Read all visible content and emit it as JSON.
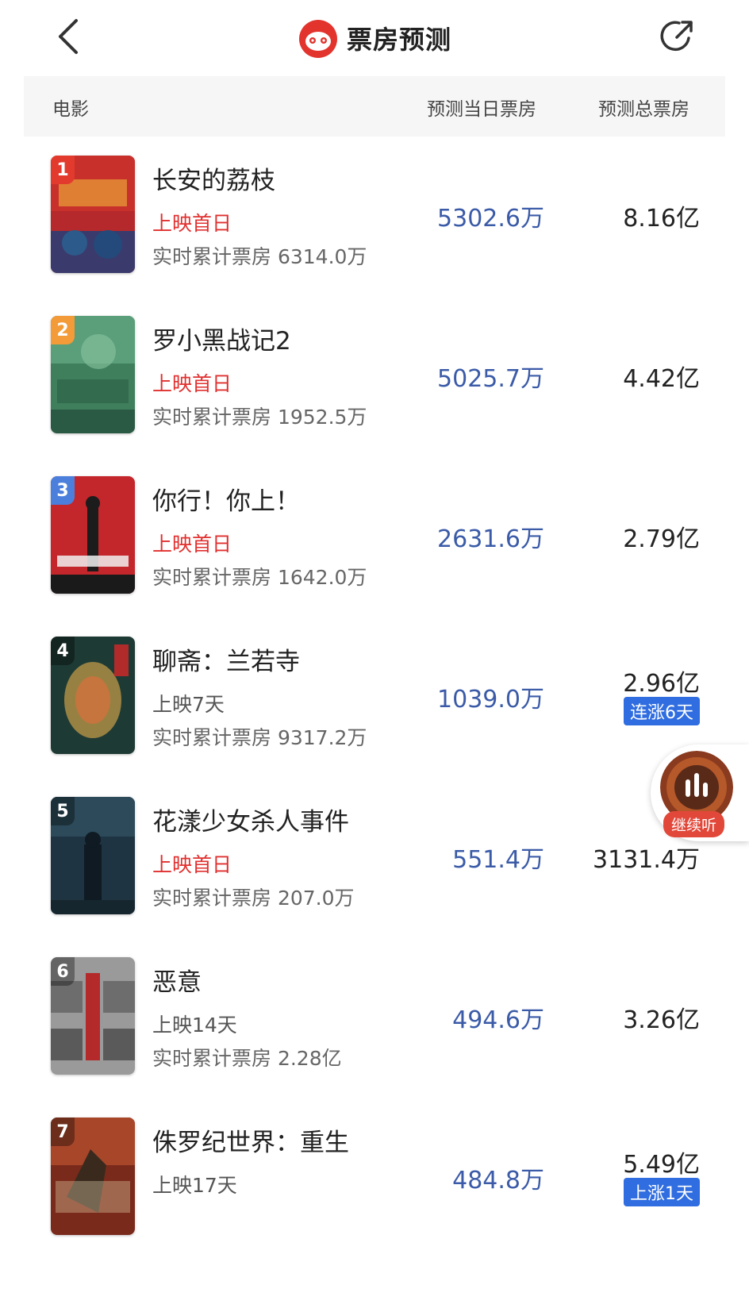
{
  "header": {
    "title": "票房预测",
    "back_icon": "chevron-left-icon",
    "share_icon": "share-arrow-icon",
    "logo_icon": "maoyan-cat-logo"
  },
  "columns": {
    "movie": "电影",
    "daily": "预测当日票房",
    "total": "预测总票房"
  },
  "movies": [
    {
      "rank": "1",
      "name": "长安的荔枝",
      "release": "上映首日",
      "cumulative": "实时累计票房 6314.0万",
      "daily": "5302.6万",
      "total": "8.16亿",
      "badge": "",
      "poster_color": "#b5282b"
    },
    {
      "rank": "2",
      "name": "罗小黑战记2",
      "release": "上映首日",
      "cumulative": "实时累计票房 1952.5万",
      "daily": "5025.7万",
      "total": "4.42亿",
      "badge": "",
      "poster_color": "#3f7f5c"
    },
    {
      "rank": "3",
      "name": "你行！你上！",
      "release": "上映首日",
      "cumulative": "实时累计票房 1642.0万",
      "daily": "2631.6万",
      "total": "2.79亿",
      "badge": "",
      "poster_color": "#c3262b"
    },
    {
      "rank": "4",
      "name": "聊斋：兰若寺",
      "release": "上映7天",
      "cumulative": "实时累计票房 9317.2万",
      "daily": "1039.0万",
      "total": "2.96亿",
      "badge": "连涨6天",
      "poster_color": "#1e3a34"
    },
    {
      "rank": "5",
      "name": "花漾少女杀人事件",
      "release": "上映首日",
      "cumulative": "实时累计票房 207.0万",
      "daily": "551.4万",
      "total": "3131.4万",
      "badge": "",
      "poster_color": "#1f3442"
    },
    {
      "rank": "6",
      "name": "恶意",
      "release": "上映14天",
      "cumulative": "实时累计票房 2.28亿",
      "daily": "494.6万",
      "total": "3.26亿",
      "badge": "",
      "poster_color": "#8a8a8a"
    },
    {
      "rank": "7",
      "name": "侏罗纪世界：重生",
      "release": "上映17天",
      "cumulative": "",
      "daily": "484.8万",
      "total": "5.49亿",
      "badge": "上涨1天",
      "poster_color": "#7a2a1a"
    }
  ],
  "float_player": {
    "label": "继续听",
    "icon": "audio-bars-icon"
  },
  "colors": {
    "accent_red": "#e0302f",
    "daily_blue": "#3b5ba8",
    "badge_blue": "#2f6de0"
  }
}
